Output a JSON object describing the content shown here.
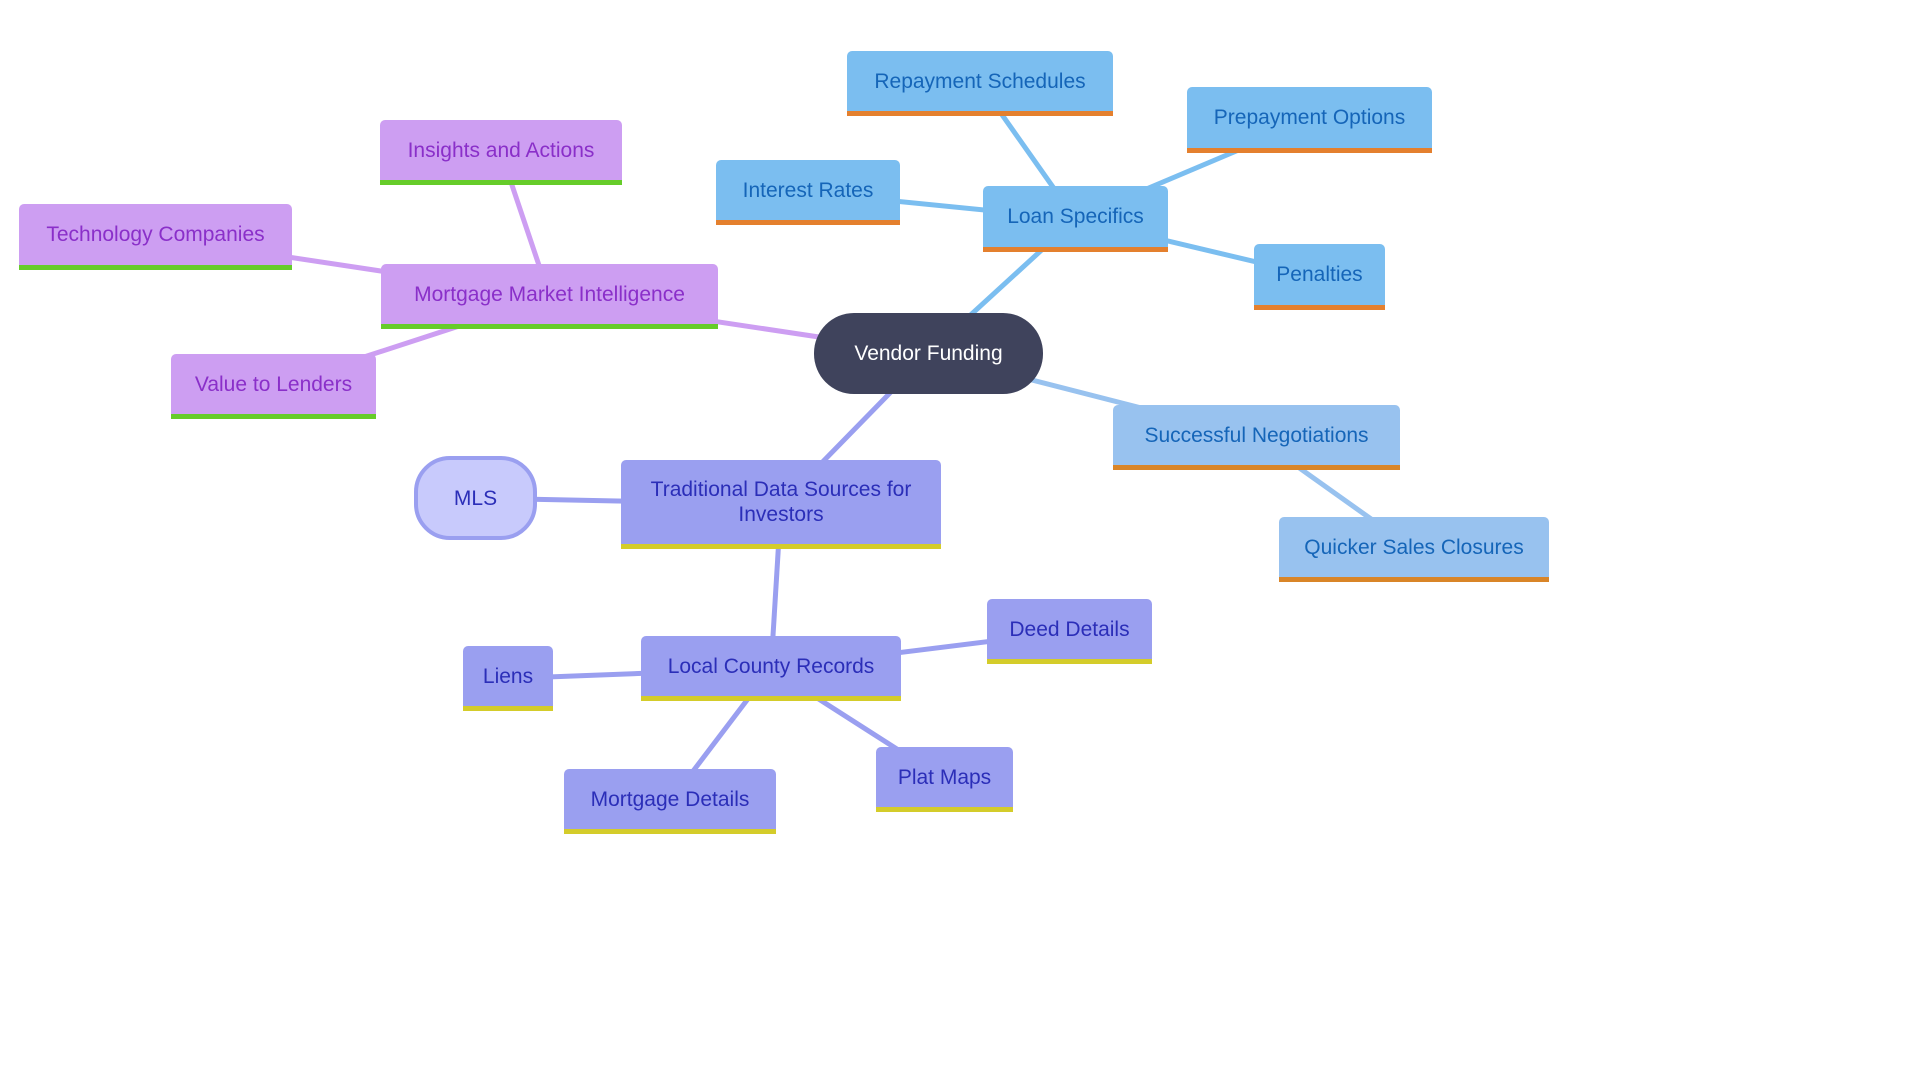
{
  "diagram": {
    "type": "mindmap",
    "root": {
      "id": "root",
      "label": "Vendor Funding"
    },
    "nodes": [
      {
        "id": "loan",
        "label": "Loan Specifics",
        "parent": "root",
        "style": "blue"
      },
      {
        "id": "repay",
        "label": "Repayment Schedules",
        "parent": "loan",
        "style": "blue"
      },
      {
        "id": "prepay",
        "label": "Prepayment Options",
        "parent": "loan",
        "style": "blue"
      },
      {
        "id": "interest",
        "label": "Interest Rates",
        "parent": "loan",
        "style": "blue"
      },
      {
        "id": "penalties",
        "label": "Penalties",
        "parent": "loan",
        "style": "blue"
      },
      {
        "id": "negot",
        "label": "Successful Negotiations",
        "parent": "root",
        "style": "blue2"
      },
      {
        "id": "quicker",
        "label": "Quicker Sales Closures",
        "parent": "negot",
        "style": "blue2"
      },
      {
        "id": "mmi",
        "label": "Mortgage Market Intelligence",
        "parent": "root",
        "style": "purple"
      },
      {
        "id": "insights",
        "label": "Insights and Actions",
        "parent": "mmi",
        "style": "purple"
      },
      {
        "id": "tech",
        "label": "Technology Companies",
        "parent": "mmi",
        "style": "purple"
      },
      {
        "id": "value",
        "label": "Value to Lenders",
        "parent": "mmi",
        "style": "purple"
      },
      {
        "id": "trad",
        "label": "Traditional Data Sources for Investors",
        "parent": "root",
        "style": "indigo"
      },
      {
        "id": "mls",
        "label": "MLS",
        "parent": "trad",
        "style": "mls"
      },
      {
        "id": "county",
        "label": "Local County Records",
        "parent": "trad",
        "style": "indigo"
      },
      {
        "id": "deed",
        "label": "Deed Details",
        "parent": "county",
        "style": "indigo"
      },
      {
        "id": "liens",
        "label": "Liens",
        "parent": "county",
        "style": "indigo"
      },
      {
        "id": "plat",
        "label": "Plat Maps",
        "parent": "county",
        "style": "indigo"
      },
      {
        "id": "mortgage",
        "label": "Mortgage Details",
        "parent": "county",
        "style": "indigo"
      }
    ],
    "colors": {
      "blue_branch": "#7bbef0",
      "blue2_branch": "#98c2ef",
      "purple_branch": "#cd9ef2",
      "indigo_branch": "#9a9ff0",
      "root": "#3f435c",
      "accent_orange": "#e4802e",
      "accent_green": "#66cc2a",
      "accent_yellow": "#d4cc2a"
    }
  }
}
